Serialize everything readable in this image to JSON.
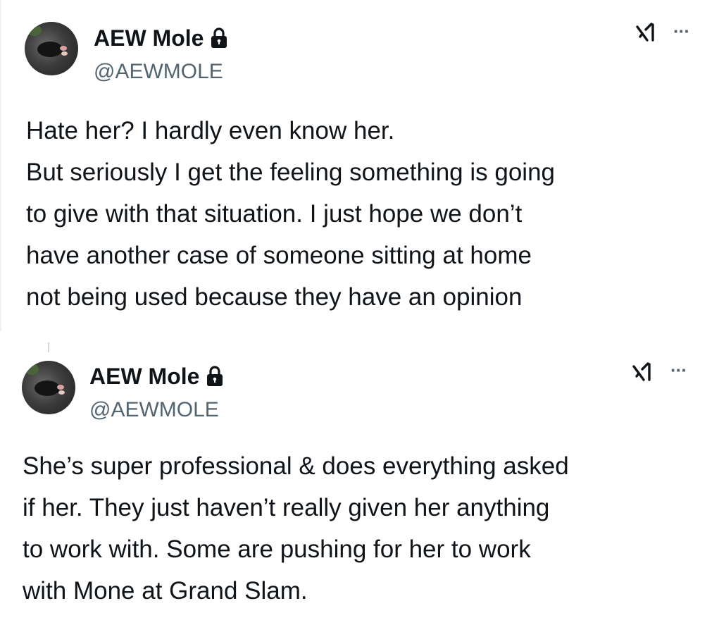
{
  "tweets": [
    {
      "display_name": "AEW Mole",
      "handle": "@AEWMOLE",
      "text": "Hate her? I hardly even know her.\nBut seriously I get the feeling something is going\nto give with that situation. I just hope we don’t\nhave another case of someone sitting at home\nnot being used because they have an opinion",
      "protected_icon": "lock-icon",
      "ai_icon": "grok-icon",
      "menu_icon": "more-icon"
    },
    {
      "display_name": "AEW Mole",
      "handle": "@AEWMOLE",
      "text": "She’s super professional & does everything asked\nif her. They just haven’t really given her anything\nto work with. Some are pushing for her to work\nwith Mone at Grand Slam.",
      "protected_icon": "lock-icon",
      "ai_icon": "grok-icon",
      "menu_icon": "more-icon"
    }
  ],
  "more_glyph": "···",
  "colors": {
    "text_primary": "#0f1419",
    "text_secondary": "#536471",
    "thread_line": "#cfd9de"
  }
}
